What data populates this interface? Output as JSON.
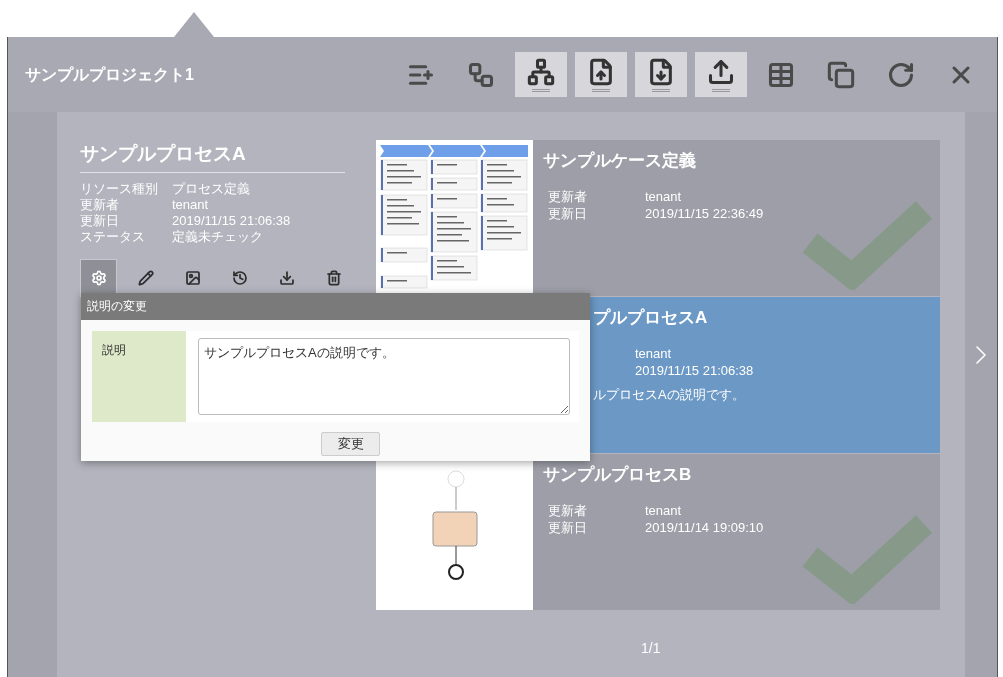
{
  "project": {
    "title": "サンプルプロジェクト1"
  },
  "toolbar": [
    {
      "highlighted": false
    },
    {
      "highlighted": false
    },
    {
      "highlighted": true
    },
    {
      "highlighted": true
    },
    {
      "highlighted": true
    },
    {
      "highlighted": true
    },
    {
      "highlighted": false
    },
    {
      "highlighted": false
    },
    {
      "highlighted": false
    },
    {
      "highlighted": false
    }
  ],
  "resource": {
    "title": "サンプルプロセスA",
    "fields": [
      {
        "label": "リソース種別",
        "value": "プロセス定義"
      },
      {
        "label": "更新者",
        "value": "tenant"
      },
      {
        "label": "更新日",
        "value": "2019/11/15 21:06:38"
      },
      {
        "label": "ステータス",
        "value": "定義未チェック"
      }
    ]
  },
  "actions": [
    {
      "selected": true
    },
    {
      "selected": false
    },
    {
      "selected": false
    },
    {
      "selected": false
    },
    {
      "selected": false
    },
    {
      "selected": false
    }
  ],
  "cards": [
    {
      "title": "サンプルケース定義",
      "selected": false,
      "checked": true,
      "fields": [
        {
          "label": "更新者",
          "value": "tenant"
        },
        {
          "label": "更新日",
          "value": "2019/11/15 22:36:49"
        }
      ]
    },
    {
      "title": "プルプロセスA",
      "selected": true,
      "checked": false,
      "fields": [
        {
          "value": "tenant"
        },
        {
          "value": "2019/11/15 21:06:38"
        }
      ],
      "description": "ルプロセスAの説明です。"
    },
    {
      "title": "サンプルプロセスB",
      "selected": false,
      "checked": true,
      "fields": [
        {
          "label": "更新者",
          "value": "tenant"
        },
        {
          "label": "更新日",
          "value": "2019/11/14 19:09:10"
        }
      ]
    }
  ],
  "pagination": "1/1",
  "dialog": {
    "title": "説明の変更",
    "field_label": "説明",
    "value": "サンプルプロセスAの説明です。",
    "button": "変更"
  }
}
